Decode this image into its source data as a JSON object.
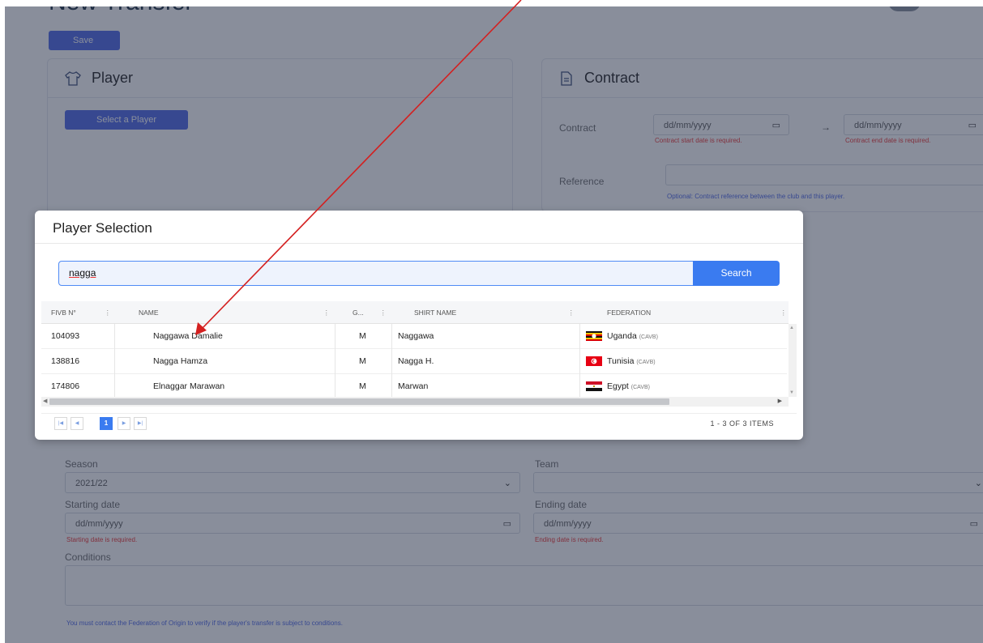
{
  "background": {
    "page_title": "New Transfer",
    "save_label": "Save",
    "player_card": {
      "title": "Player",
      "select_button": "Select a Player"
    },
    "contract_card": {
      "title": "Contract",
      "contract_label": "Contract",
      "start_placeholder": "dd/mm/yyyy",
      "end_placeholder": "dd/mm/yyyy",
      "start_error": "Contract start date is required.",
      "end_error": "Contract end date is required.",
      "reference_label": "Reference",
      "reference_hint": "Optional: Contract reference between the club and this player."
    },
    "transfer_form": {
      "season_label": "Season",
      "season_value": "2021/22",
      "team_label": "Team",
      "starting_label": "Starting date",
      "starting_placeholder": "dd/mm/yyyy",
      "starting_error": "Starting date is required.",
      "ending_label": "Ending date",
      "ending_placeholder": "dd/mm/yyyy",
      "ending_error": "Ending date is required.",
      "conditions_label": "Conditions",
      "conditions_hint": "You must contact the Federation of Origin to verify if the player's transfer is subject to conditions."
    }
  },
  "modal": {
    "title": "Player Selection",
    "search_value": "nagga",
    "search_button": "Search",
    "columns": [
      "FIVB N°",
      "NAME",
      "G...",
      "SHIRT NAME",
      "FEDERATION"
    ],
    "rows": [
      {
        "fivb": "104093",
        "name": "Naggawa Damalie",
        "gender": "M",
        "shirt": "Naggawa",
        "federation": "Uganda",
        "confed": "(CAVB)",
        "flag": "uganda-flag"
      },
      {
        "fivb": "138816",
        "name": "Nagga Hamza",
        "gender": "M",
        "shirt": "Nagga H.",
        "federation": "Tunisia",
        "confed": "(CAVB)",
        "flag": "tunisia-flag"
      },
      {
        "fivb": "174806",
        "name": "Elnaggar Marawan",
        "gender": "M",
        "shirt": "Marwan",
        "federation": "Egypt",
        "confed": "(CAVB)",
        "flag": "egypt-flag"
      }
    ],
    "pager": {
      "current_page": "1",
      "info": "1 - 3 OF 3 ITEMS"
    }
  },
  "colors": {
    "accent": "#3a7bf0",
    "error": "#e44444",
    "annotation_arrow": "#d42020"
  }
}
